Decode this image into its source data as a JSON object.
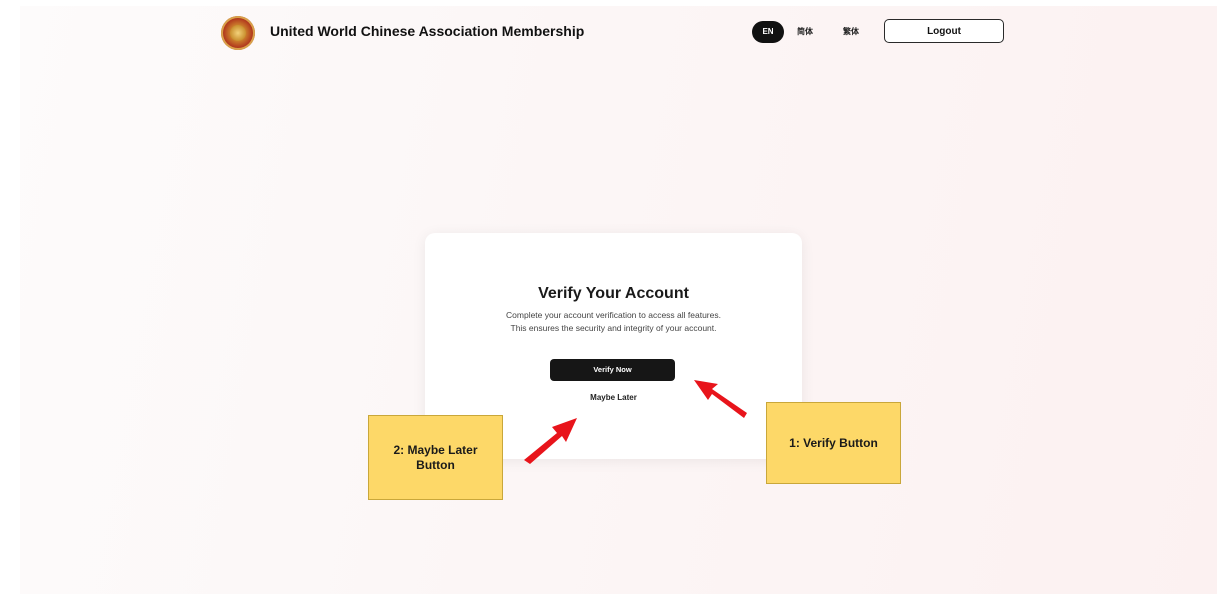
{
  "header": {
    "logo_name": "association-logo",
    "title": "United World Chinese Association Membership",
    "languages": [
      {
        "label": "EN",
        "active": true
      },
      {
        "label": "简体",
        "active": false
      },
      {
        "label": "繁体",
        "active": false
      }
    ],
    "logout_label": "Logout"
  },
  "verify_card": {
    "title": "Verify Your Account",
    "description_line1": "Complete your account verification to access all features.",
    "description_line2": "This ensures the security and integrity of your account.",
    "verify_button_label": "Verify Now",
    "maybe_later_label": "Maybe Later"
  },
  "annotations": {
    "maybe_later_note": "2: Maybe Later Button",
    "verify_note": "1: Verify Button",
    "note_color": "#fdd868",
    "arrow_color": "#e8141b"
  },
  "colors": {
    "primary_button": "#161616",
    "active_language": "#111111",
    "background": "#fcf6f6"
  }
}
